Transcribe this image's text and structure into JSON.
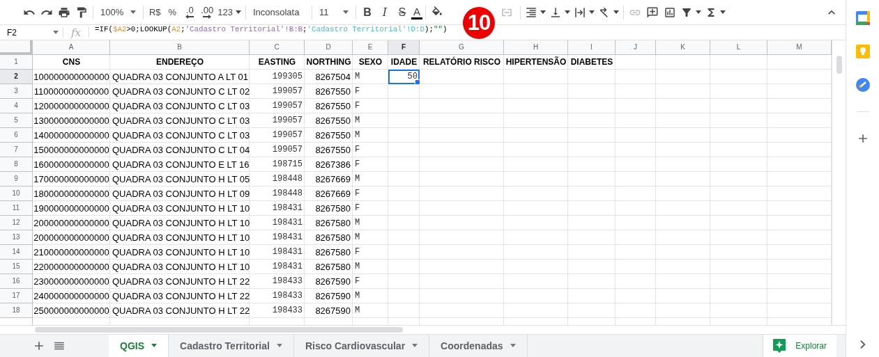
{
  "toolbar": {
    "zoom": "100%",
    "number_formats": [
      "R$",
      "%",
      ".0",
      ".00",
      "123"
    ],
    "font": "Inconsolata",
    "font_size": "11",
    "text_styles": [
      "B",
      "I",
      "S",
      "A"
    ]
  },
  "badge": "10",
  "formula_bar": {
    "name_box": "F2",
    "function_symbol": "fx",
    "formula": [
      {
        "text": "=IF("
      },
      {
        "text": "$A2",
        "color": "#e69138"
      },
      {
        "text": ">0;LOOKUP("
      },
      {
        "text": "A2",
        "color": "#e69138"
      },
      {
        "text": ";"
      },
      {
        "text": "'Cadastro Territorial'!B:B",
        "color": "#8e63ce"
      },
      {
        "text": ";"
      },
      {
        "text": "'Cadastro Territorial'!D:D",
        "color": "#46bdc6"
      },
      {
        "text": ");"
      },
      {
        "text": "\"\"",
        "color": "#188038"
      },
      {
        "text": ")"
      }
    ]
  },
  "columns": [
    {
      "label": "A",
      "selected": false
    },
    {
      "label": "B",
      "selected": false
    },
    {
      "label": "C",
      "selected": false
    },
    {
      "label": "D",
      "selected": false
    },
    {
      "label": "E",
      "selected": false
    },
    {
      "label": "F",
      "selected": true
    },
    {
      "label": "G",
      "selected": false
    },
    {
      "label": "H",
      "selected": false
    },
    {
      "label": "I",
      "selected": false
    },
    {
      "label": "J",
      "selected": false
    },
    {
      "label": "K",
      "selected": false
    },
    {
      "label": "L",
      "selected": false
    },
    {
      "label": "M",
      "selected": false
    }
  ],
  "rows": [
    {
      "number": "1",
      "selected": false,
      "cells": [
        "CNS",
        "ENDEREÇO",
        "EASTING",
        "NORTHING",
        "SEXO",
        "IDADE",
        "RELATÓRIO RISCO",
        "HIPERTENSÃO",
        "DIABETES"
      ]
    },
    {
      "number": "2",
      "selected": true,
      "cells": [
        "100000000000000",
        "QUADRA 03 CONJUNTO A LT 01",
        "199305",
        "8267504",
        "M",
        "50"
      ]
    },
    {
      "number": "3",
      "selected": false,
      "cells": [
        "110000000000000",
        "QUADRA 03 CONJUNTO C LT 02",
        "199057",
        "8267550",
        "F"
      ]
    },
    {
      "number": "4",
      "selected": false,
      "cells": [
        "120000000000000",
        "QUADRA 03 CONJUNTO C LT 03",
        "199057",
        "8267550",
        "F"
      ]
    },
    {
      "number": "5",
      "selected": false,
      "cells": [
        "130000000000000",
        "QUADRA 03 CONJUNTO C LT 03",
        "199057",
        "8267550",
        "M"
      ]
    },
    {
      "number": "6",
      "selected": false,
      "cells": [
        "140000000000000",
        "QUADRA 03 CONJUNTO C LT 03",
        "199057",
        "8267550",
        "M"
      ]
    },
    {
      "number": "7",
      "selected": false,
      "cells": [
        "150000000000000",
        "QUADRA 03 CONJUNTO C LT 04",
        "199057",
        "8267550",
        "F"
      ]
    },
    {
      "number": "8",
      "selected": false,
      "cells": [
        "160000000000000",
        "QUADRA 03 CONJUNTO E LT 16",
        "198715",
        "8267386",
        "F"
      ]
    },
    {
      "number": "9",
      "selected": false,
      "cells": [
        "170000000000000",
        "QUADRA 03 CONJUNTO H LT 05",
        "198448",
        "8267669",
        "M"
      ]
    },
    {
      "number": "10",
      "selected": false,
      "cells": [
        "180000000000000",
        "QUADRA 03 CONJUNTO H LT 09",
        "198448",
        "8267669",
        "F"
      ]
    },
    {
      "number": "11",
      "selected": false,
      "cells": [
        "190000000000000",
        "QUADRA 03 CONJUNTO H LT 10",
        "198431",
        "8267580",
        "F"
      ]
    },
    {
      "number": "12",
      "selected": false,
      "cells": [
        "200000000000000",
        "QUADRA 03 CONJUNTO H LT 10",
        "198431",
        "8267580",
        "M"
      ]
    },
    {
      "number": "13",
      "selected": false,
      "cells": [
        "200000000000000",
        "QUADRA 03 CONJUNTO H LT 10",
        "198431",
        "8267580",
        "M"
      ]
    },
    {
      "number": "14",
      "selected": false,
      "cells": [
        "210000000000000",
        "QUADRA 03 CONJUNTO H LT 10",
        "198431",
        "8267580",
        "F"
      ]
    },
    {
      "number": "15",
      "selected": false,
      "cells": [
        "220000000000000",
        "QUADRA 03 CONJUNTO H LT 10",
        "198431",
        "8267580",
        "M"
      ]
    },
    {
      "number": "16",
      "selected": false,
      "cells": [
        "230000000000000",
        "QUADRA 03 CONJUNTO H LT 22",
        "198433",
        "8267590",
        "F"
      ]
    },
    {
      "number": "17",
      "selected": false,
      "cells": [
        "240000000000000",
        "QUADRA 03 CONJUNTO H LT 22",
        "198433",
        "8267590",
        "M"
      ]
    },
    {
      "number": "18",
      "selected": false,
      "cells": [
        "250000000000000",
        "QUADRA 03 CONJUNTO H LT 22",
        "198433",
        "8267590",
        "M"
      ]
    }
  ],
  "sheet_tabs": [
    {
      "label": "QGIS",
      "selected": true
    },
    {
      "label": "Cadastro Territorial",
      "selected": false
    },
    {
      "label": "Risco Cardiovascular",
      "selected": false
    },
    {
      "label": "Coordenadas",
      "selected": false
    }
  ],
  "explore_button": "Explorar"
}
